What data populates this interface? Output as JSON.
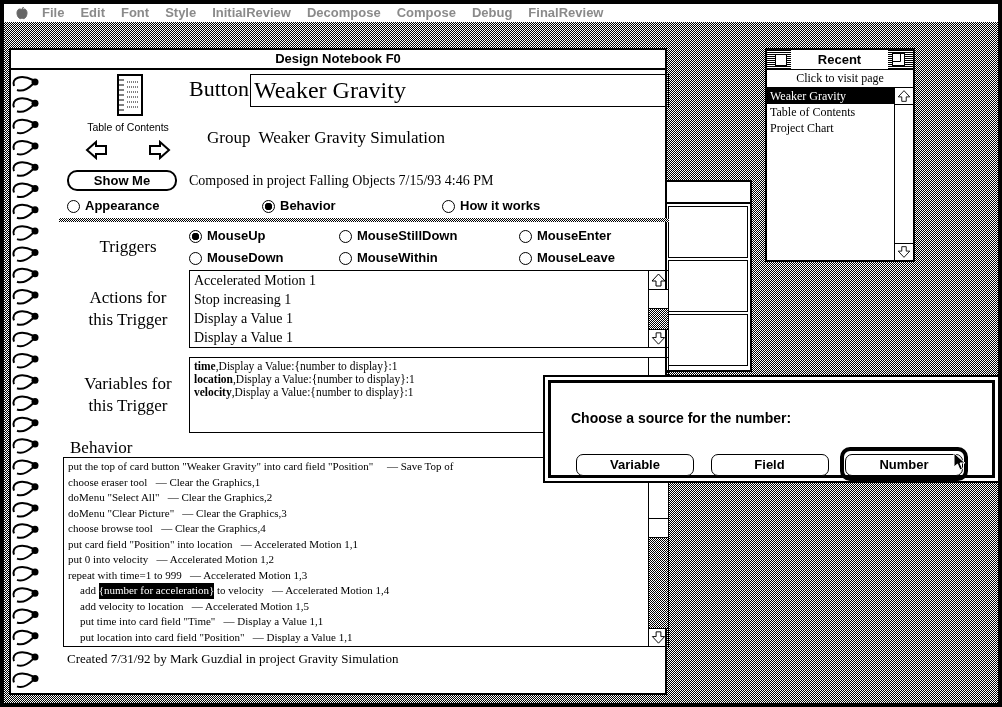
{
  "menu_bar": {
    "items": [
      {
        "label": "File",
        "disabled": true
      },
      {
        "label": "Edit",
        "disabled": true
      },
      {
        "label": "Font",
        "disabled": true
      },
      {
        "label": "Style",
        "disabled": true
      },
      {
        "label": "InitialReview",
        "disabled": true
      },
      {
        "label": "Decompose",
        "disabled": true
      },
      {
        "label": "Compose",
        "disabled": true
      },
      {
        "label": "Debug",
        "disabled": true
      },
      {
        "label": "FinalReview",
        "disabled": true
      }
    ]
  },
  "notebook": {
    "title": "Design Notebook F0",
    "toc_label": "Table of Contents",
    "button_label": "Button",
    "button_name": "Weaker Gravity",
    "group_label": "Group",
    "group_name": "Weaker Gravity Simulation",
    "show_me": "Show Me",
    "composed": "Composed in project Falling Objects 7/15/93 4:46 PM",
    "views": [
      {
        "label": "Appearance",
        "selected": false
      },
      {
        "label": "Behavior",
        "selected": true
      },
      {
        "label": "How it works",
        "selected": false
      }
    ],
    "triggers_label": "Triggers",
    "triggers": [
      {
        "label": "MouseUp",
        "selected": true
      },
      {
        "label": "MouseStillDown",
        "selected": false
      },
      {
        "label": "MouseEnter",
        "selected": false
      },
      {
        "label": "MouseDown",
        "selected": false
      },
      {
        "label": "MouseWithin",
        "selected": false
      },
      {
        "label": "MouseLeave",
        "selected": false
      }
    ],
    "actions_label": "Actions for this Trigger",
    "actions": [
      "Accelerated Motion 1",
      "Stop increasing 1",
      "Display a Value 1",
      "Display a Value 1"
    ],
    "variables_label": "Variables for this Trigger",
    "variables": [
      "**time**,Display a Value:{number to display}:1",
      "**location**,Display a Value:{number to display}:1",
      "**velocity**,Display a Value:{number to display}:1"
    ],
    "behavior_label": "Behavior",
    "script": [
      {
        "parts": [
          {
            "text": "put the top of card button \"Weaker Gravity\" into card field \"Position\"     — Save Top of",
            "selected": false
          }
        ]
      },
      {
        "parts": [
          {
            "text": "choose eraser tool   — Clear the Graphics,1",
            "selected": false
          }
        ]
      },
      {
        "parts": [
          {
            "text": "doMenu \"Select All\"   — Clear the Graphics,2",
            "selected": false
          }
        ]
      },
      {
        "parts": [
          {
            "text": "doMenu \"Clear Picture\"   — Clear the Graphics,3",
            "selected": false
          }
        ]
      },
      {
        "parts": [
          {
            "text": "choose browse tool   — Clear the Graphics,4",
            "selected": false
          }
        ]
      },
      {
        "parts": [
          {
            "text": "put card field \"Position\" into location   — Accelerated Motion 1,1",
            "selected": false
          }
        ]
      },
      {
        "parts": [
          {
            "text": "put 0 into velocity   — Accelerated Motion 1,2",
            "selected": false
          }
        ]
      },
      {
        "parts": [
          {
            "text": "repeat with time=1 to 999   — Accelerated Motion 1,3",
            "selected": false
          }
        ],
        "children": [
          {
            "parts": [
              {
                "text": "add ",
                "selected": false
              },
              {
                "text": "{number for acceleration}",
                "selected": true
              },
              {
                "text": " to velocity   — Accelerated Motion 1,4",
                "selected": false
              }
            ]
          },
          {
            "parts": [
              {
                "text": "add velocity to location   — Accelerated Motion 1,5",
                "selected": false
              }
            ]
          },
          {
            "parts": [
              {
                "text": "put time into card field \"Time\"   — Display a Value 1,1",
                "selected": false
              }
            ]
          },
          {
            "parts": [
              {
                "text": "put location into card field \"Position\"   — Display a Value 1,1",
                "selected": false
              }
            ]
          }
        ]
      }
    ],
    "created": "Created 7/31/92 by Mark Guzdial in project Gravity Simulation"
  },
  "recent": {
    "title": "Recent",
    "hint": "Click to visit page",
    "items": [
      {
        "label": "Weaker Gravity",
        "selected": true
      },
      {
        "label": "Table of Contents",
        "selected": false
      },
      {
        "label": "Project Chart",
        "selected": false
      }
    ]
  },
  "dialog": {
    "prompt": "Choose a source for the number:",
    "buttons": [
      {
        "label": "Variable",
        "default": false
      },
      {
        "label": "Field",
        "default": false
      },
      {
        "label": "Number",
        "default": true
      }
    ]
  }
}
